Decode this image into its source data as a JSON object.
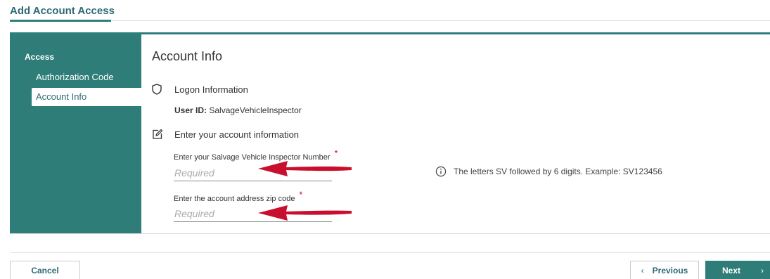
{
  "header": {
    "title": "Add Account Access"
  },
  "sidebar": {
    "heading": "Access",
    "items": [
      {
        "label": "Authorization Code",
        "active": false
      },
      {
        "label": "Account Info",
        "active": true
      }
    ]
  },
  "main": {
    "section_title": "Account Info",
    "logon": {
      "icon": "shield-icon",
      "label": "Logon Information"
    },
    "user_id": {
      "label": "User ID:",
      "value": "SalvageVehicleInspector"
    },
    "account": {
      "icon": "edit-icon",
      "label": "Enter your account information"
    },
    "fields": [
      {
        "label": "Enter your Salvage Vehicle Inspector Number",
        "required_marker": "*",
        "placeholder": "Required",
        "value": ""
      },
      {
        "label": "Enter the account address zip code",
        "required_marker": "*",
        "placeholder": "Required",
        "value": ""
      }
    ],
    "hint": {
      "icon": "info-icon",
      "text": "The letters SV followed by 6 digits.  Example:  SV123456"
    }
  },
  "footer": {
    "cancel_label": "Cancel",
    "previous_label": "Previous",
    "next_label": "Next",
    "previous_icon": "chevron-left-icon",
    "next_icon": "chevron-right-icon"
  },
  "colors": {
    "accent": "#2f7d78",
    "title": "#2f6a73",
    "required": "#d0021b",
    "annotation_arrow": "#c8102e"
  }
}
